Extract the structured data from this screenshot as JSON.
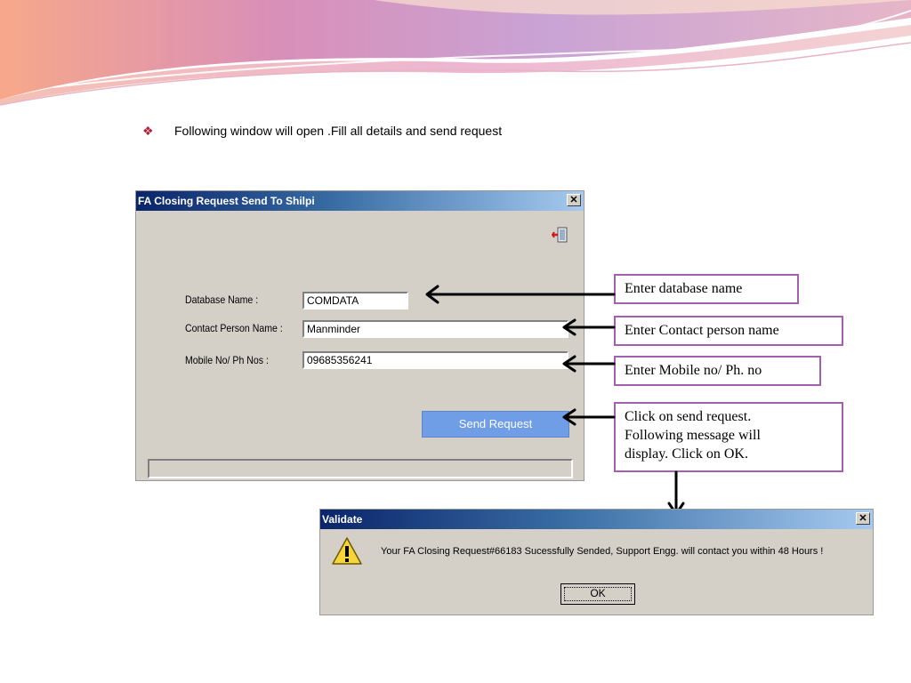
{
  "slide": {
    "bullet_text": "Following window will open .Fill all details and send request",
    "bullet_glyph": "❖"
  },
  "request_dialog": {
    "title": "FA Closing Request Send To Shilpi",
    "close_glyph": "✕",
    "fields": {
      "database_label": "Database Name :",
      "database_value": "COMDATA",
      "contact_label": "Contact Person Name :",
      "contact_value": "Manminder",
      "mobile_label": "Mobile No/ Ph Nos :",
      "mobile_value": "09685356241"
    },
    "send_label": "Send Request",
    "exit_icon": "exit-door-icon"
  },
  "callouts": {
    "database": "Enter database name",
    "contact": "Enter  Contact person name",
    "mobile": "Enter Mobile no/ Ph. no",
    "send_line1": "Click on send request.",
    "send_line2": "Following message will",
    "send_line3": "display. Click on OK."
  },
  "validate_dialog": {
    "title": "Validate",
    "close_glyph": "✕",
    "message": "Your FA Closing Request#66183 Sucessfully Sended, Support Engg. will contact you within 48 Hours !",
    "ok_label": "OK",
    "icon": "warning-icon"
  },
  "colors": {
    "callout_border": "#a45fb0",
    "titlebar_start": "#0a246a",
    "titlebar_end": "#a6caf0",
    "send_button": "#6f9de6",
    "bullet": "#b3203a"
  }
}
